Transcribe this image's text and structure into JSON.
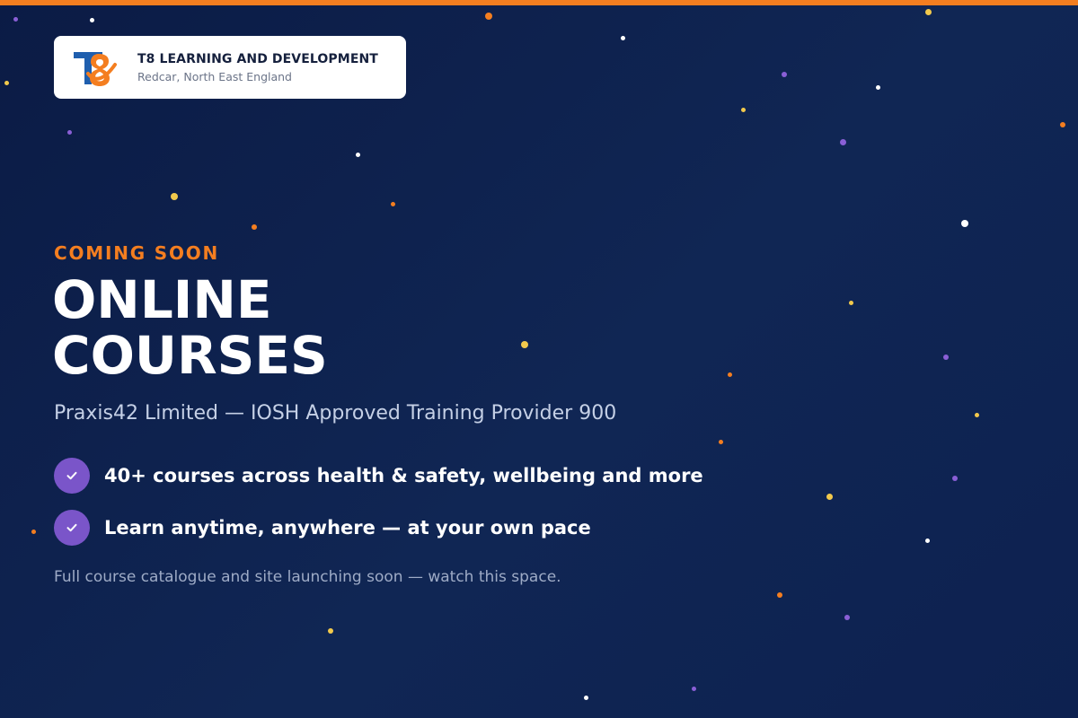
{
  "theme": {
    "accent": "#f47e20",
    "background": "#0d2150",
    "check_circle": "#7a55c9",
    "logo_blue": "#1f5fae",
    "logo_orange": "#f47e20"
  },
  "brand": {
    "logo_icon": "t8-logo-icon",
    "name": "T8 LEARNING AND DEVELOPMENT",
    "location": "Redcar, North East England"
  },
  "hero": {
    "eyebrow": "COMING SOON",
    "title_line1": "ONLINE",
    "title_line2": "COURSES",
    "subtitle": "Praxis42 Limited — IOSH Approved Training Provider 900"
  },
  "features": [
    {
      "icon": "check-icon",
      "text": "40+ courses across health & safety, wellbeing and more"
    },
    {
      "icon": "check-icon",
      "text": "Learn anytime, anywhere — at your own pace"
    }
  ],
  "footnote": "Full course catalogue and site launching soon — watch this space."
}
